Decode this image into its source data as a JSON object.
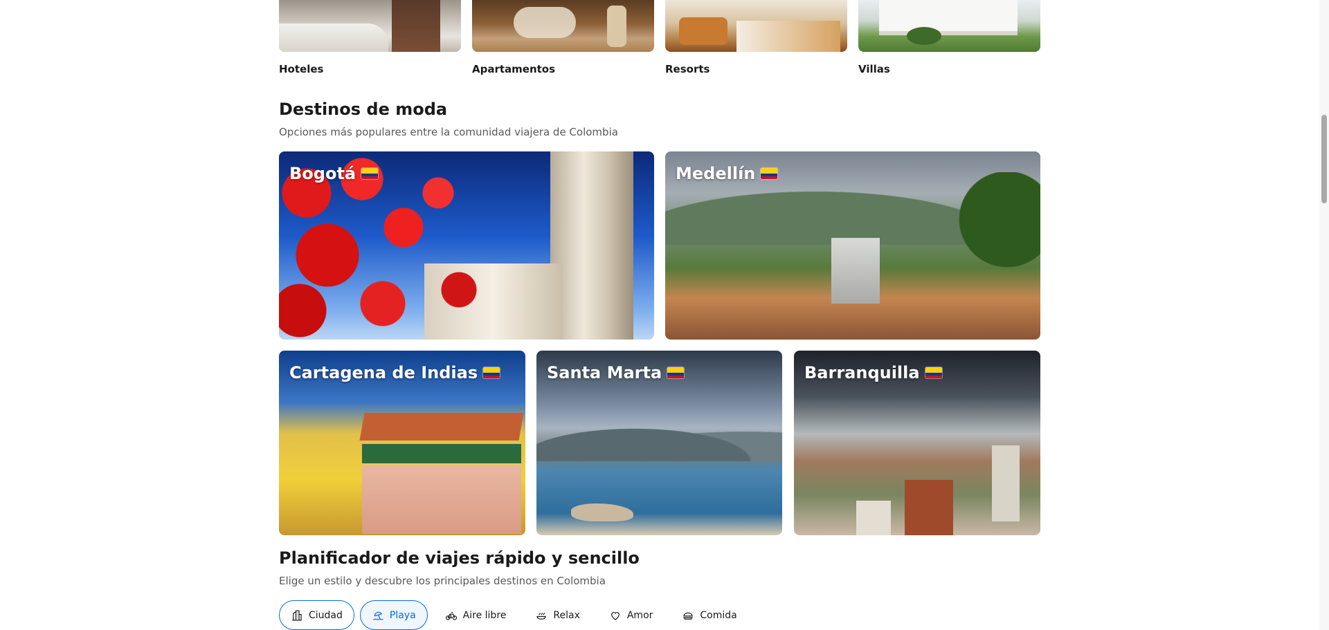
{
  "property_types": [
    {
      "label": "Hoteles"
    },
    {
      "label": "Apartamentos"
    },
    {
      "label": "Resorts"
    },
    {
      "label": "Villas"
    }
  ],
  "trending": {
    "title": "Destinos de moda",
    "subtitle": "Opciones más populares entre la comunidad viajera de Colombia",
    "destinations": [
      {
        "name": "Bogotá",
        "flag_icon": "colombia-flag-icon"
      },
      {
        "name": "Medellín",
        "flag_icon": "colombia-flag-icon"
      },
      {
        "name": "Cartagena de Indias",
        "flag_icon": "colombia-flag-icon"
      },
      {
        "name": "Santa Marta",
        "flag_icon": "colombia-flag-icon"
      },
      {
        "name": "Barranquilla",
        "flag_icon": "colombia-flag-icon"
      }
    ]
  },
  "planner": {
    "title": "Planificador de viajes rápido y sencillo",
    "subtitle": "Elige un estilo y descubre los principales destinos en Colombia",
    "chips": [
      {
        "label": "Ciudad",
        "icon": "city-icon"
      },
      {
        "label": "Playa",
        "icon": "beach-icon",
        "selected": true
      },
      {
        "label": "Aire libre",
        "icon": "bicycle-icon"
      },
      {
        "label": "Relax",
        "icon": "spa-icon"
      },
      {
        "label": "Amor",
        "icon": "heart-icon"
      },
      {
        "label": "Comida",
        "icon": "food-icon"
      }
    ]
  },
  "colors": {
    "accent": "#006ce4",
    "text": "#1a1a1a",
    "subtext": "#595959"
  }
}
